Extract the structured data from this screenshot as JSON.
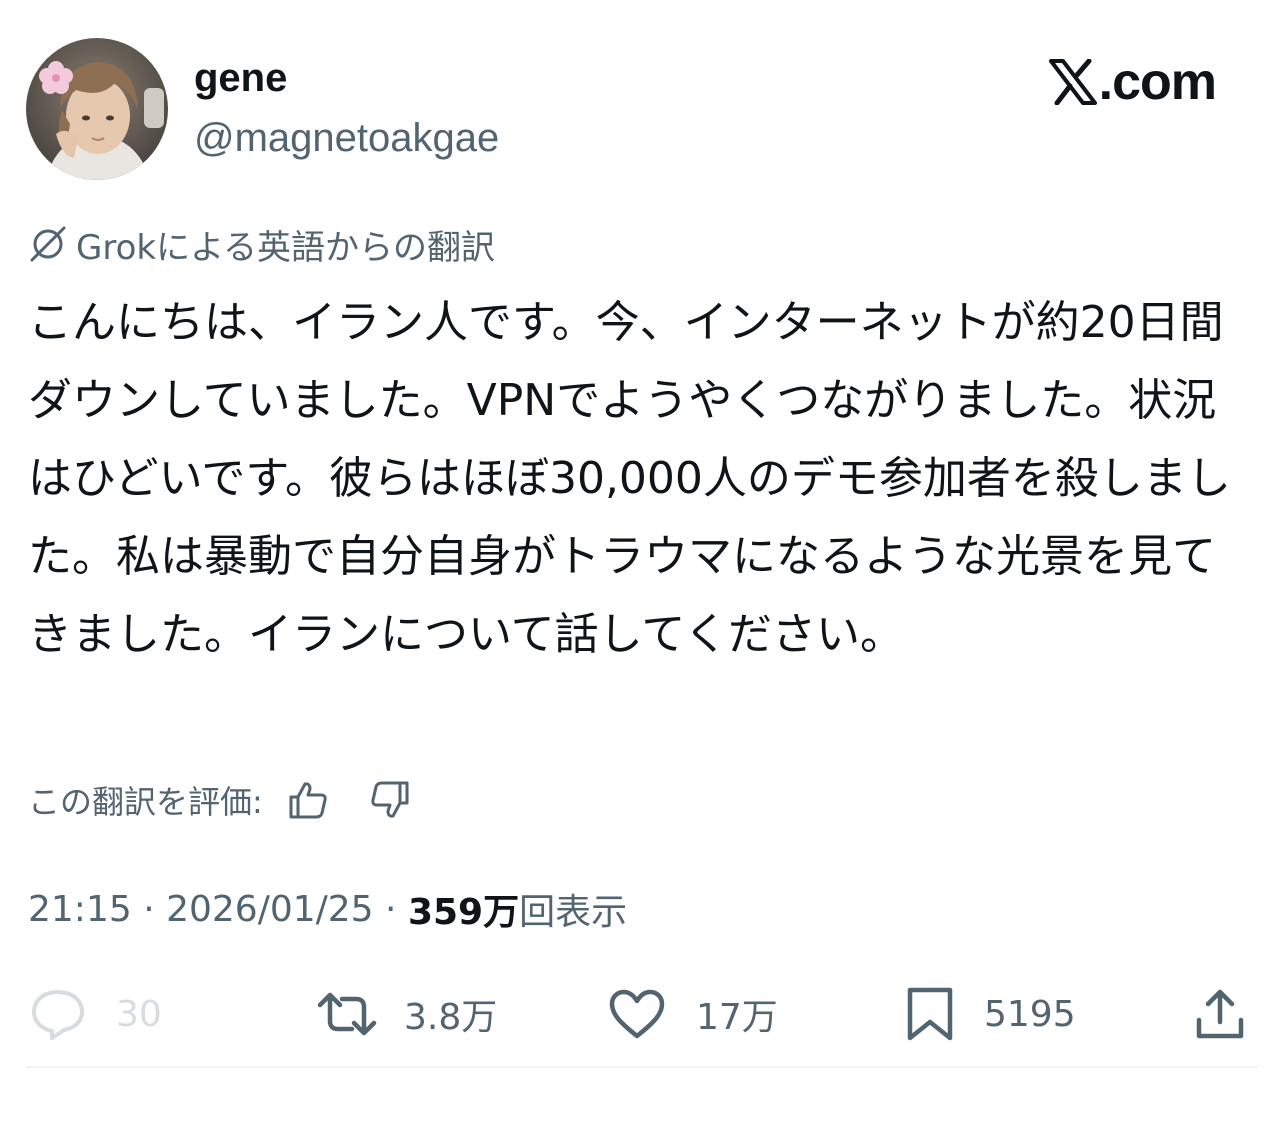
{
  "author": {
    "display_name": "gene",
    "handle": "@magnetoakgae"
  },
  "brand": {
    "logo_icon": "x-logo-icon",
    "text": ".com"
  },
  "translation": {
    "icon": "grok-icon",
    "label": "Grokによる英語からの翻訳"
  },
  "tweet": {
    "text": "こんにちは、イラン人です。今、インターネットが約20日間ダウンしていました。VPNでようやくつながりました。状況はひどいです。彼らはほぼ30,000人のデモ参加者を殺しました。私は暴動で自分自身がトラウマになるような光景を見てきました。イランについて話してください。"
  },
  "rating": {
    "label": "この翻訳を評価:",
    "up_icon": "thumbs-up-icon",
    "down_icon": "thumbs-down-icon"
  },
  "meta": {
    "time": "21:15",
    "separator": " · ",
    "date": "2026/01/25",
    "views_count": "359万",
    "views_label": "回表示"
  },
  "actions": {
    "reply": {
      "icon": "reply-icon",
      "count": "30"
    },
    "retweet": {
      "icon": "retweet-icon",
      "count": "3.8万"
    },
    "like": {
      "icon": "heart-icon",
      "count": "17万"
    },
    "bookmark": {
      "icon": "bookmark-icon",
      "count": "5195"
    },
    "share": {
      "icon": "share-icon"
    }
  },
  "colors": {
    "text_primary": "#0f1419",
    "text_secondary": "#536471",
    "text_disabled": "#d7dce0",
    "divider": "#eff3f4"
  }
}
